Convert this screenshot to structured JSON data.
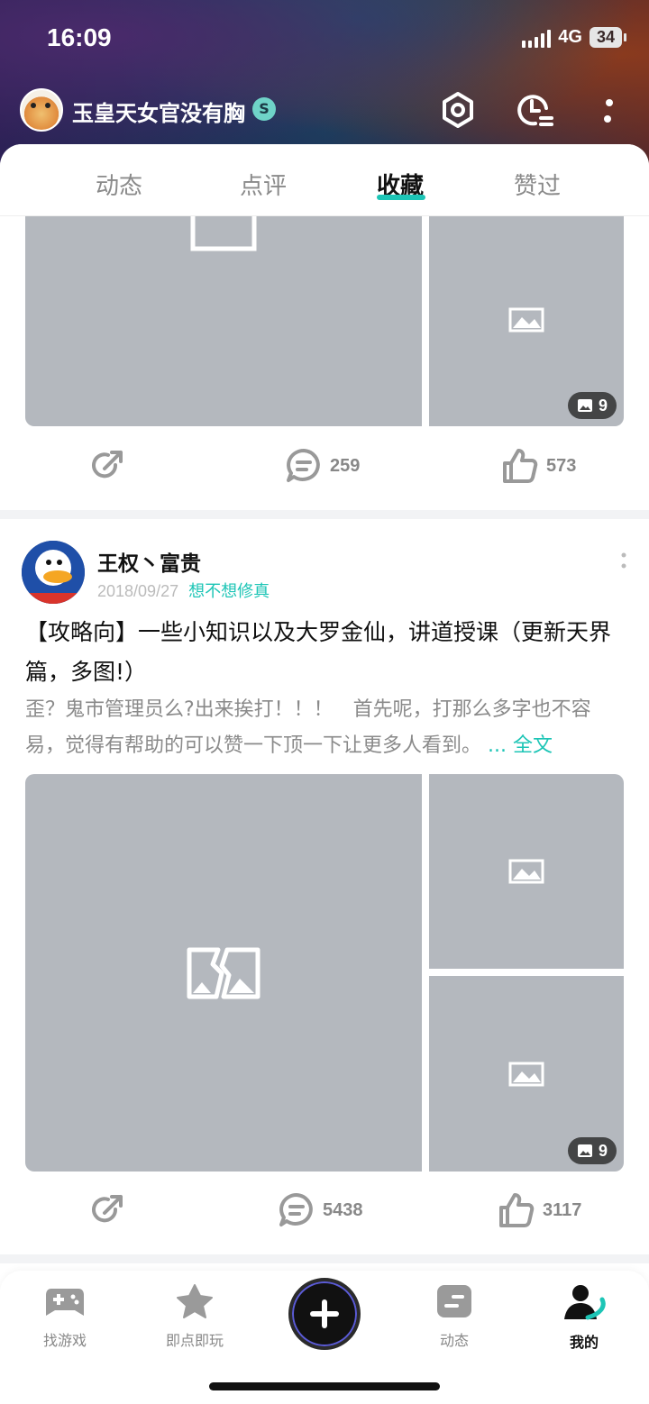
{
  "status": {
    "time": "16:09",
    "network": "4G",
    "battery": "34"
  },
  "profile": {
    "username": "玉皇天女官没有胸",
    "verify_badge": "S"
  },
  "tabs": [
    {
      "label": "动态"
    },
    {
      "label": "点评"
    },
    {
      "label": "收藏"
    },
    {
      "label": "赞过"
    }
  ],
  "post1": {
    "image_count": "9",
    "comments": "259",
    "likes": "573"
  },
  "post2": {
    "author": "王权丶富贵",
    "date": "2018/09/27",
    "channel": "想不想修真",
    "title": "【攻略向】一些小知识以及大罗金仙，讲道授课（更新天界篇，多图!）",
    "body": "歪？鬼市管理员么?出来挨打！！！　首先呢，打那么多字也不容易，觉得有帮助的可以赞一下顶一下让更多人看到。",
    "full_text_link": "... 全文",
    "image_count": "9",
    "comments": "5438",
    "likes": "3117"
  },
  "bottom_nav": [
    {
      "label": "找游戏",
      "icon": "gamepad-icon"
    },
    {
      "label": "即点即玩",
      "icon": "star-icon"
    },
    {
      "label": "",
      "icon": "plus-icon"
    },
    {
      "label": "动态",
      "icon": "feed-icon"
    },
    {
      "label": "我的",
      "icon": "profile-icon"
    }
  ],
  "colors": {
    "accent": "#1dc5b6",
    "image_placeholder": "#b4b8be"
  }
}
